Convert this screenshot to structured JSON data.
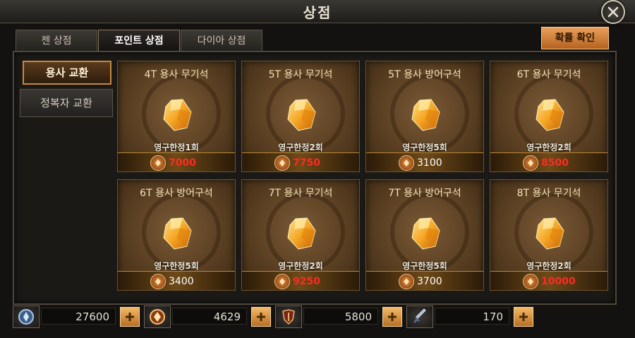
{
  "window": {
    "title": "상점"
  },
  "tabs": [
    {
      "label": "젠 상점"
    },
    {
      "label": "포인트 상점",
      "active": true
    },
    {
      "label": "다이아 상점"
    }
  ],
  "probability_button": "확률 확인",
  "sidebar": [
    {
      "label": "용사 교환",
      "active": true
    },
    {
      "label": "정복자 교환"
    }
  ],
  "items": [
    {
      "title": "4T 용사 무기석",
      "limit": "영구한정1회",
      "price": "7000",
      "price_insufficient": true
    },
    {
      "title": "5T 용사 무기석",
      "limit": "영구한정2회",
      "price": "7750",
      "price_insufficient": true
    },
    {
      "title": "5T 용사 방어구석",
      "limit": "영구한정5회",
      "price": "3100",
      "price_insufficient": false
    },
    {
      "title": "6T 용사 무기석",
      "limit": "영구한정2회",
      "price": "8500",
      "price_insufficient": true
    },
    {
      "title": "6T 용사 방어구석",
      "limit": "영구한정5회",
      "price": "3400",
      "price_insufficient": false
    },
    {
      "title": "7T 용사 무기석",
      "limit": "영구한정2회",
      "price": "9250",
      "price_insufficient": true
    },
    {
      "title": "7T 용사 방어구석",
      "limit": "영구한정5회",
      "price": "3700",
      "price_insufficient": false
    },
    {
      "title": "8T 용사 무기석",
      "limit": "영구한정2회",
      "price": "10000",
      "price_insufficient": true
    }
  ],
  "currencies": [
    {
      "icon": "blue-emblem-icon",
      "value": "27600"
    },
    {
      "icon": "point-coin-icon",
      "value": "4629"
    },
    {
      "icon": "crest-icon",
      "value": "5800"
    },
    {
      "icon": "sword-icon",
      "value": "170"
    }
  ],
  "colors": {
    "accent": "#c8893f",
    "insufficient_price": "#ff2a22",
    "gem": "#f5a623"
  }
}
